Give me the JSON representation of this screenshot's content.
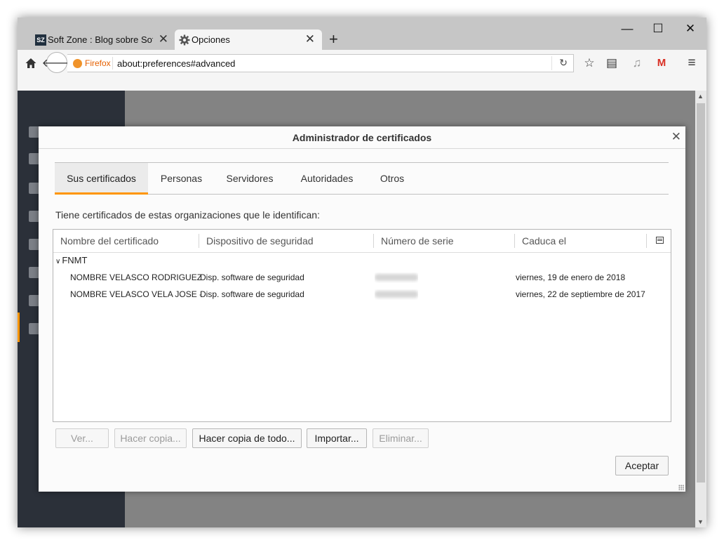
{
  "browser": {
    "tabs": [
      {
        "title": "Soft Zone : Blog sobre Sof...",
        "favicon": "softzone-logo-icon",
        "active": false
      },
      {
        "title": "Opciones",
        "favicon": "gear-icon",
        "active": true
      }
    ],
    "url": "about:preferences#advanced",
    "identity_label": "Firefox",
    "window_controls": {
      "minimize": "—",
      "maximize": "☐",
      "close": "✕"
    }
  },
  "dialog": {
    "title": "Administrador de certificados",
    "tabs": [
      "Sus certificados",
      "Personas",
      "Servidores",
      "Autoridades",
      "Otros"
    ],
    "selected_tab": "Sus certificados",
    "intro": "Tiene certificados de estas organizaciones que le identifican:",
    "columns": [
      "Nombre del certificado",
      "Dispositivo de seguridad",
      "Número de serie",
      "Caduca el"
    ],
    "groups": [
      {
        "name": "FNMT",
        "rows": [
          {
            "name": "NOMBRE VELASCO RODRIGUEZ ...",
            "device": "Disp. software de seguridad",
            "serial_blurred": true,
            "expires": "viernes, 19 de enero de 2018"
          },
          {
            "name": "NOMBRE VELASCO VELA JOSE - ...",
            "device": "Disp. software de seguridad",
            "serial_blurred": true,
            "expires": "viernes, 22 de septiembre de 2017"
          }
        ]
      }
    ],
    "buttons": {
      "view": "Ver...",
      "backup": "Hacer copia...",
      "backup_all": "Hacer copia de todo...",
      "import": "Importar...",
      "delete": "Eliminar...",
      "accept": "Aceptar"
    }
  },
  "colors": {
    "accent": "#ff9500",
    "sidebar": "#2b3039",
    "firefox_orange": "#e66000"
  }
}
